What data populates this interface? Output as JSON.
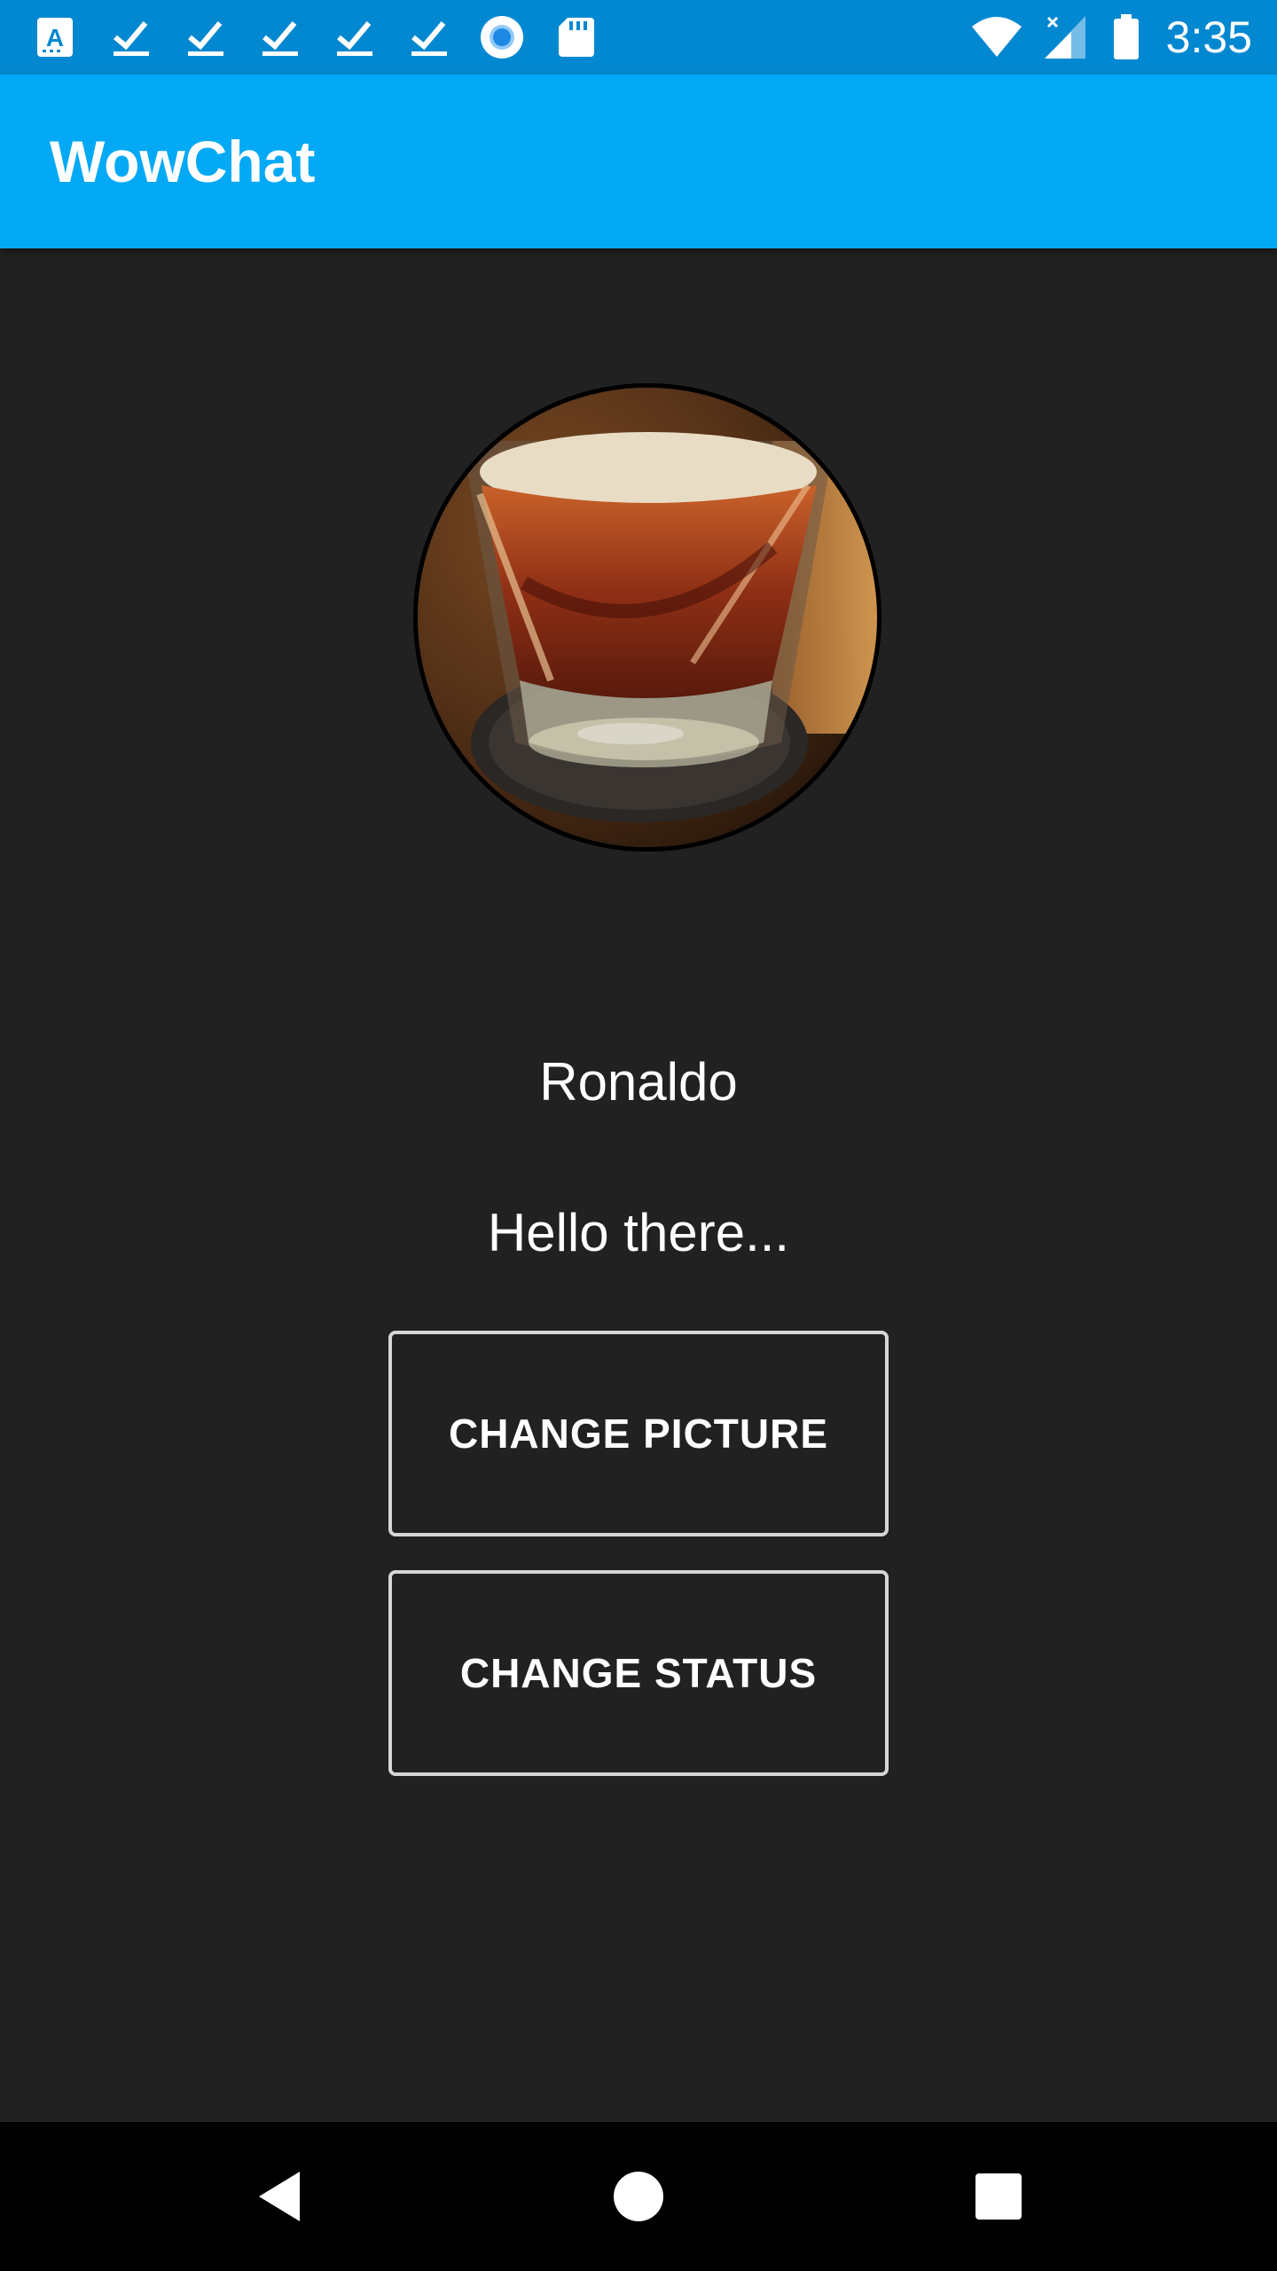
{
  "status_bar": {
    "time": "3:35",
    "left_icons": [
      "keyboard-a-icon",
      "download-done-icon",
      "download-done-icon",
      "download-done-icon",
      "download-done-icon",
      "download-done-icon",
      "record-icon",
      "sd-card-icon"
    ],
    "right_icons": [
      "wifi-icon",
      "cell-signal-icon",
      "battery-icon"
    ]
  },
  "app_bar": {
    "title": "WowChat",
    "color": "#03a9f4"
  },
  "profile": {
    "avatar_icon": "profile-photo",
    "name": "Ronaldo",
    "status": "Hello there..."
  },
  "buttons": {
    "change_picture": "CHANGE PICTURE",
    "change_status": "CHANGE STATUS"
  },
  "nav_bar": {
    "icons": [
      "back-icon",
      "home-icon",
      "recents-icon"
    ]
  },
  "colors": {
    "status_bar": "#0288d1",
    "background": "#212121",
    "button_border": "#d6d6d6"
  }
}
